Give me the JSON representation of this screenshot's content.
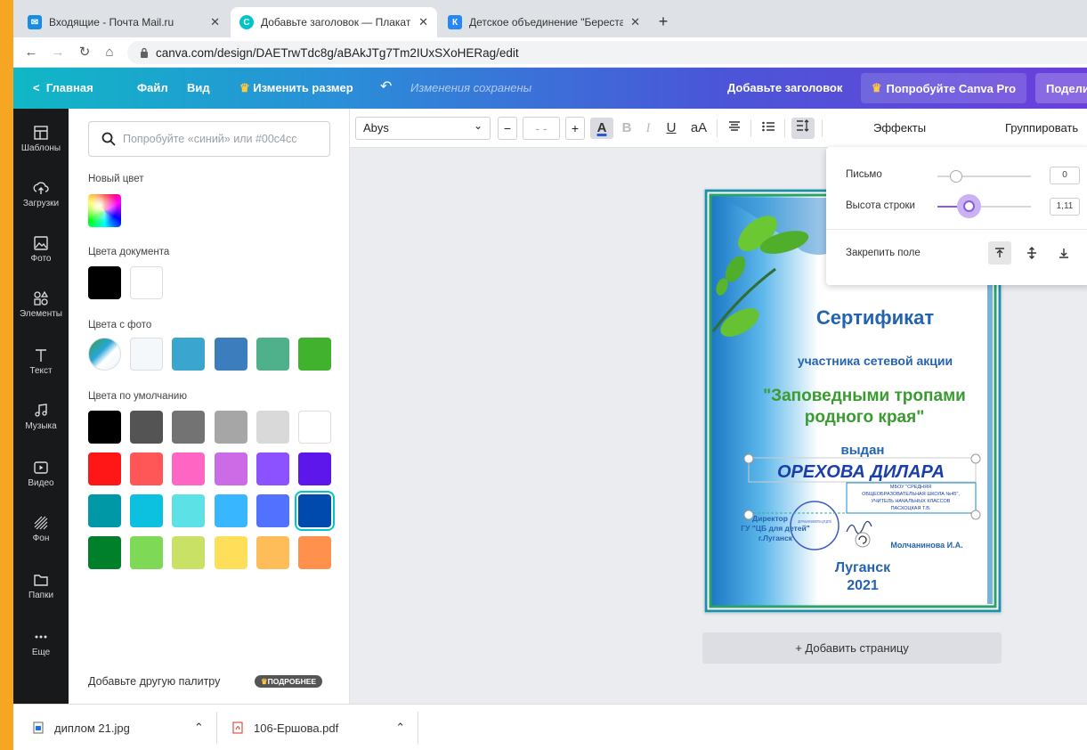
{
  "browser": {
    "tabs": [
      {
        "title": "Входящие - Почта Mail.ru",
        "icon": "mail-icon",
        "color": "#168de2",
        "active": false
      },
      {
        "title": "Добавьте заголовок — Плакат",
        "icon": "canva-icon",
        "color": "#00c4cc",
        "active": true
      },
      {
        "title": "Детское объединение \"Береста",
        "icon": "vk-icon",
        "color": "#2787f5",
        "active": false
      }
    ],
    "close_glyph": "✕",
    "new_tab_glyph": "+",
    "url": "canva.com/design/DAETrwTdc8g/aBAkJTg7Tm2IUxSXoHERag/edit"
  },
  "canva_bar": {
    "home": "Главная",
    "file": "Файл",
    "view": "Вид",
    "resize": "Изменить размер",
    "saved": "Изменения сохранены",
    "doc_title": "Добавьте заголовок",
    "try_pro": "Попробуйте Canva Pro",
    "share": "Поделиться"
  },
  "rail": [
    {
      "label": "Шаблоны",
      "icon": "templates-icon"
    },
    {
      "label": "Загрузки",
      "icon": "upload-icon"
    },
    {
      "label": "Фото",
      "icon": "photo-icon"
    },
    {
      "label": "Элементы",
      "icon": "elements-icon"
    },
    {
      "label": "Текст",
      "icon": "text-icon"
    },
    {
      "label": "Музыка",
      "icon": "music-icon"
    },
    {
      "label": "Видео",
      "icon": "video-icon"
    },
    {
      "label": "Фон",
      "icon": "background-icon"
    },
    {
      "label": "Папки",
      "icon": "folder-icon"
    },
    {
      "label": "Еще",
      "icon": "more-icon"
    }
  ],
  "panel": {
    "search_placeholder": "Попробуйте «синий» или #00c4cc",
    "new_color_label": "Новый цвет",
    "doc_colors_label": "Цвета документа",
    "doc_colors": [
      "#000000",
      "#ffffff"
    ],
    "photo_colors_label": "Цвета с фото",
    "photo_colors": [
      "#f5f8fa",
      "#3aa6cf",
      "#3b7dbd",
      "#4fb08c",
      "#40b22e"
    ],
    "default_colors_label": "Цвета по умолчанию",
    "default_colors": [
      "#000000",
      "#545454",
      "#737373",
      "#a6a6a6",
      "#d9d9d9",
      "#ffffff",
      "#ff1616",
      "#ff5757",
      "#ff66c4",
      "#cb6ce6",
      "#8c52ff",
      "#5e17eb",
      "#0097a7",
      "#0cc0df",
      "#5ce1e6",
      "#38b6ff",
      "#5271ff",
      "#004aad",
      "#00802b",
      "#7ed957",
      "#c9e265",
      "#ffde59",
      "#ffbd59",
      "#ff914d"
    ],
    "selected_default_index": 17,
    "palette_footer": "Добавьте другую палитру",
    "more_button": "ПОДРОБНЕЕ"
  },
  "toolbar": {
    "font": "Abys",
    "minus": "−",
    "size": "- -",
    "plus": "+",
    "color_letter": "A",
    "bold": "B",
    "italic": "I",
    "underline": "U",
    "case": "aA",
    "effects": "Эффекты",
    "group": "Группировать"
  },
  "spacing_popup": {
    "letter_label": "Письмо",
    "letter_value": "0",
    "letter_fraction": 0.2,
    "line_label": "Высота строки",
    "line_value": "1,11",
    "line_fraction": 0.33,
    "anchor_label": "Закрепить поле"
  },
  "certificate": {
    "title": "Сертификат",
    "line1": "участника сетевой акции",
    "line2a": "\"Заповедными тропами",
    "line2b": "родного края\"",
    "issued": "выдан",
    "name": "ОРЕХОВА ДИЛАРА",
    "school1": "МБОУ \"СРЕДНЯЯ",
    "school2": "ОБЩЕОБРАЗОВАТЕЛЬНАЯ ШКОЛА №45\",",
    "school3": "УЧИТЕЛЬ НАЧАЛЬНЫХ КЛАССОВ",
    "school4": "ПАСХОЦКАЯ Т.В.",
    "director1": "Директор",
    "director2": "ГУ \"ЦБ для детей\"",
    "director3": "г.Луганск",
    "signer": "Молчанинова И.А.",
    "stamp_text": "ЦЕНТРАЛЬНАЯ БИБЛИОТЕКА ДЛЯ ДЕТЕЙ",
    "city": "Луганск",
    "year": "2021"
  },
  "add_page": "+ Добавить страницу",
  "downloads": [
    {
      "name": "диплом 21.jpg",
      "icon": "image-file-icon"
    },
    {
      "name": "106-Ершова.pdf",
      "icon": "pdf-file-icon"
    }
  ]
}
